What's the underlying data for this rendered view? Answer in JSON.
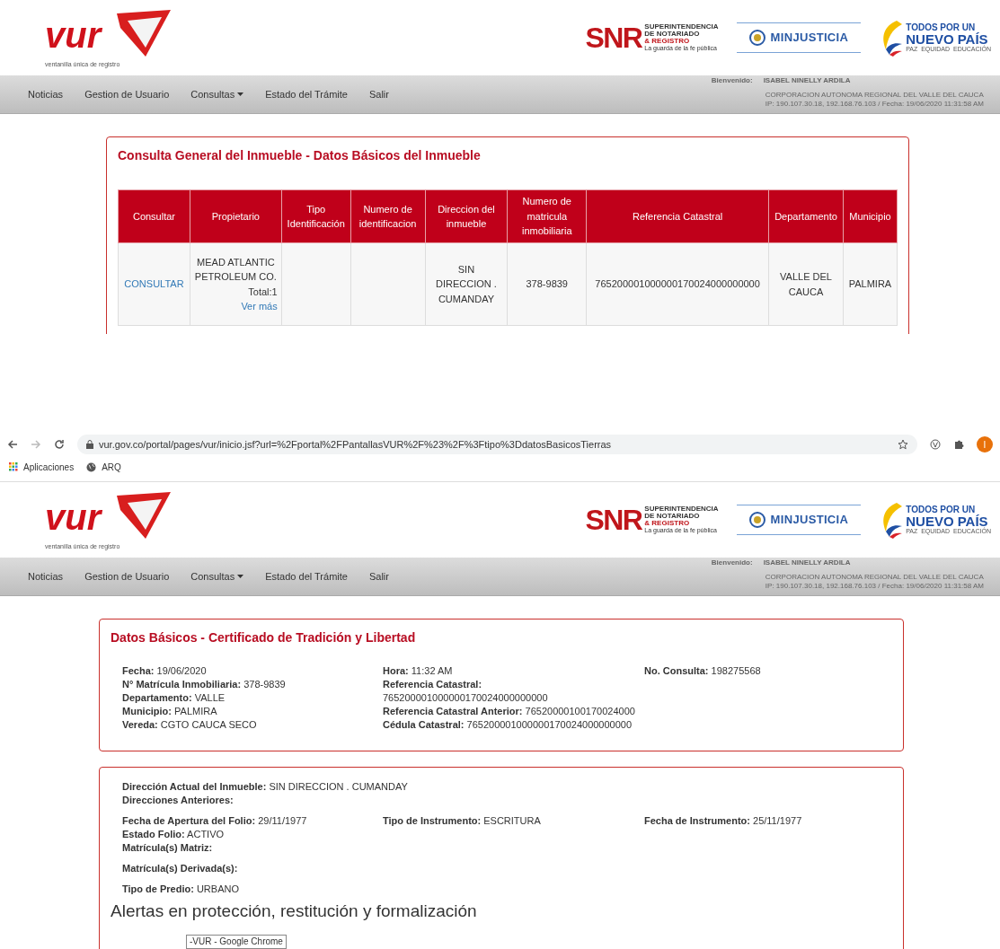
{
  "shot_1": {
    "header": {
      "logo_word": "vur",
      "logo_tagline": "ventanilla única de registro",
      "snr": {
        "mark": "SNR",
        "lines": [
          "SUPERINTENDENCIA",
          "DE NOTARIADO"
        ],
        "accent": "& REGISTRO",
        "motto": "La guarda de la fe pública"
      },
      "minjusticia": "MINJUSTICIA",
      "gov": {
        "top": "TODOS POR UN",
        "main": "NUEVO PAÍS",
        "motto": "PAZ  EQUIDAD  EDUCACIÓN"
      }
    },
    "nav": [
      {
        "label": "Noticias",
        "kind": "link"
      },
      {
        "label": "Gestion de Usuario",
        "kind": "link"
      },
      {
        "label": "Consultas",
        "kind": "dropdown"
      },
      {
        "label": "Estado del Trámite",
        "kind": "link"
      },
      {
        "label": "Salir",
        "kind": "link"
      }
    ],
    "user": {
      "label": "Bienvenido:",
      "name": "ISABEL NINELLY ARDILA",
      "org": "CORPORACION AUTONOMA REGIONAL DEL VALLE DEL CAUCA",
      "session": "IP: 190.107.30.18, 192.168.76.103 / Fecha: 19/06/2020 11:31:58 AM"
    },
    "panel": {
      "title": "Consulta General del Inmueble - Datos Básicos del Inmueble",
      "table": {
        "columns": [
          "Consultar",
          "Propietario",
          "Tipo Identificación",
          "Numero de identificacion",
          "Direccion del inmueble",
          "Numero de matricula inmobiliaria",
          "Referencia Catastral",
          "Departamento",
          "Municipio"
        ],
        "rows": [
          {
            "cells": [
              {
                "kind": "link",
                "text": "CONSULTAR"
              },
              {
                "kind": "owner",
                "text": "MEAD ATLANTIC PETROLEUM CO.",
                "total": "Total:1",
                "link": "Ver más"
              },
              {
                "kind": "empty"
              },
              {
                "kind": "empty"
              },
              {
                "kind": "text",
                "text": "SIN DIRECCION . CUMANDAY"
              },
              {
                "kind": "text",
                "text": "378-9839"
              },
              {
                "kind": "text",
                "text": "765200001000000170024000000000"
              },
              {
                "kind": "text",
                "text": "VALLE DEL CAUCA"
              },
              {
                "kind": "text",
                "text": "PALMIRA"
              }
            ]
          }
        ]
      }
    }
  },
  "browser": {
    "url": "vur.gov.co/portal/pages/vur/inicio.jsf?url=%2Fportal%2FPantallasVUR%2F%23%2F%3Ftipo%3DdatosBasicosTierras",
    "forward_disabled": true,
    "profile_initial": "I",
    "bookmarks": [
      {
        "label": "Aplicaciones",
        "kind": "apps"
      },
      {
        "label": "ARQ",
        "kind": "globe"
      }
    ]
  },
  "shot_2": {
    "header": {
      "logo_word": "vur",
      "logo_tagline": "ventanilla única de registro",
      "snr": {
        "mark": "SNR",
        "lines": [
          "SUPERINTENDENCIA",
          "DE NOTARIADO"
        ],
        "accent": "& REGISTRO",
        "motto": "La guarda de la fe pública"
      },
      "minjusticia": "MINJUSTICIA",
      "gov": {
        "top": "TODOS POR UN",
        "main": "NUEVO PAÍS",
        "motto": "PAZ  EQUIDAD  EDUCACIÓN"
      }
    },
    "nav": [
      {
        "label": "Noticias",
        "kind": "link"
      },
      {
        "label": "Gestion de Usuario",
        "kind": "link"
      },
      {
        "label": "Consultas",
        "kind": "dropdown"
      },
      {
        "label": "Estado del Trámite",
        "kind": "link"
      },
      {
        "label": "Salir",
        "kind": "link"
      }
    ],
    "user": {
      "label": "Bienvenido:",
      "name": "ISABEL NINELLY ARDILA",
      "org": "CORPORACION AUTONOMA REGIONAL DEL VALLE DEL CAUCA",
      "session": "IP: 190.107.30.18, 192.168.76.103 / Fecha: 19/06/2020 11:31:58 AM"
    },
    "basic_data": {
      "title": "Datos Básicos - Certificado de Tradición y Libertad",
      "columns": [
        [
          {
            "label": "Fecha:",
            "value": "19/06/2020"
          },
          {
            "label": "N° Matrícula Inmobiliaria:",
            "value": "378-9839"
          },
          {
            "label": "Departamento:",
            "value": "VALLE"
          },
          {
            "label": "Municipio:",
            "value": "PALMIRA"
          },
          {
            "label": "Vereda:",
            "value": "CGTO CAUCA SECO"
          }
        ],
        [
          {
            "label": "Hora:",
            "value": "11:32 AM"
          },
          {
            "label": "Referencia Catastral:",
            "value": "765200001000000170024000000000"
          },
          {
            "label": "Referencia Catastral Anterior:",
            "value": "76520000100170024000"
          },
          {
            "label": "Cédula Catastral:",
            "value": "765200001000000170024000000000"
          }
        ],
        [
          {
            "label": "No. Consulta:",
            "value": "198275568"
          }
        ]
      ]
    },
    "property": {
      "groups": [
        {
          "columns": [
            [
              {
                "label": "Dirección Actual del Inmueble:",
                "value": "SIN DIRECCION . CUMANDAY"
              },
              {
                "label": "Direcciones Anteriores:"
              }
            ]
          ]
        },
        {
          "columns": [
            [
              {
                "label": "Fecha de Apertura del Folio:",
                "value": "29/11/1977"
              },
              {
                "label": "Estado Folio:",
                "value": "ACTIVO"
              },
              {
                "label": "Matrícula(s) Matriz:"
              }
            ],
            [
              {
                "label": "Tipo de Instrumento:",
                "value": "ESCRITURA"
              }
            ],
            [
              {
                "label": "Fecha de Instrumento:",
                "value": "25/11/1977"
              }
            ]
          ]
        },
        {
          "columns": [
            [
              {
                "label": "Matrícula(s) Derivada(s):"
              }
            ]
          ]
        },
        {
          "columns": [
            [
              {
                "label": "Tipo de Predio:",
                "value": "URBANO"
              }
            ]
          ]
        }
      ],
      "section_heading": "Alertas en protección, restitución y formalización"
    },
    "tooltip": "-VUR - Google Chrome"
  }
}
